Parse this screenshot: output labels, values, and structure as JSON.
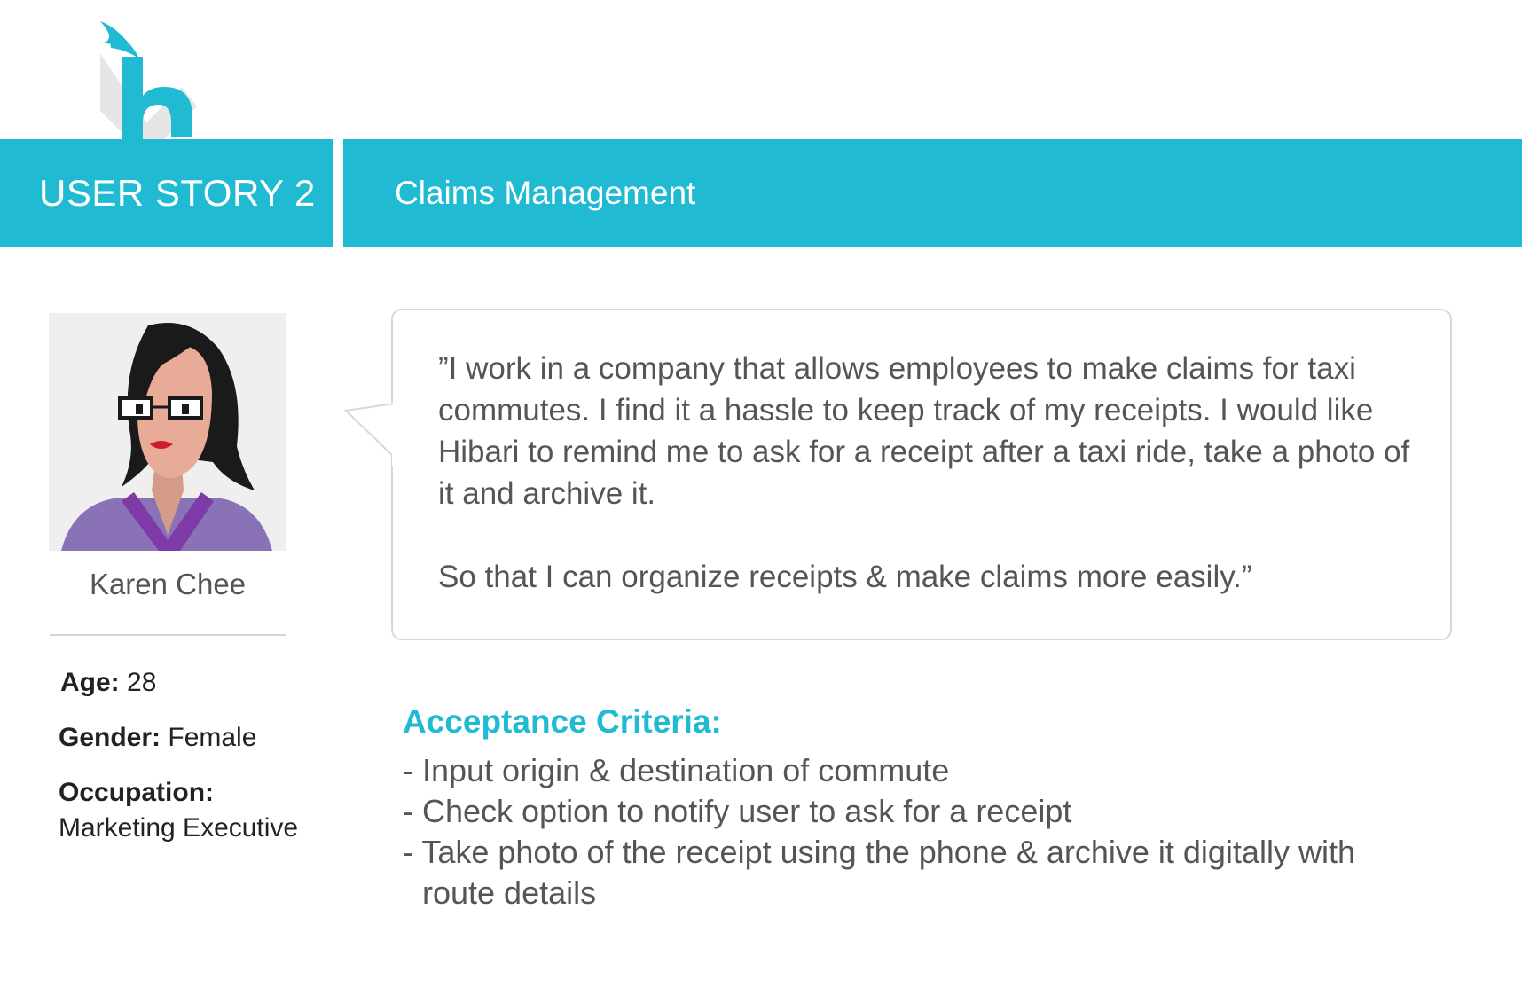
{
  "header": {
    "story_label": "USER STORY 2",
    "story_title": "Claims Management"
  },
  "colors": {
    "accent": "#20bbd3",
    "text": "#555555",
    "dark_text": "#222222"
  },
  "persona": {
    "avatar_icon": "woman-with-glasses-avatar-icon",
    "name": "Karen Chee",
    "age_label": "Age:",
    "age": "28",
    "gender_label": "Gender:",
    "gender": "Female",
    "occupation_label": "Occupation:",
    "occupation": "Marketing Executive"
  },
  "quote": {
    "paragraph1": "”I work in a company that allows employees to make claims for taxi commutes. I find it a hassle to keep track of my receipts. I would like Hibari to remind me to ask for a receipt after a taxi ride, take a photo of it and archive it.",
    "paragraph2": "So that I can organize receipts & make claims more easily.”"
  },
  "criteria": {
    "heading": "Acceptance Criteria:",
    "items": [
      "- Input origin & destination of commute",
      "- Check option to notify user to ask for a receipt",
      "- Take photo of the receipt using the phone & archive it digitally with route details"
    ]
  }
}
